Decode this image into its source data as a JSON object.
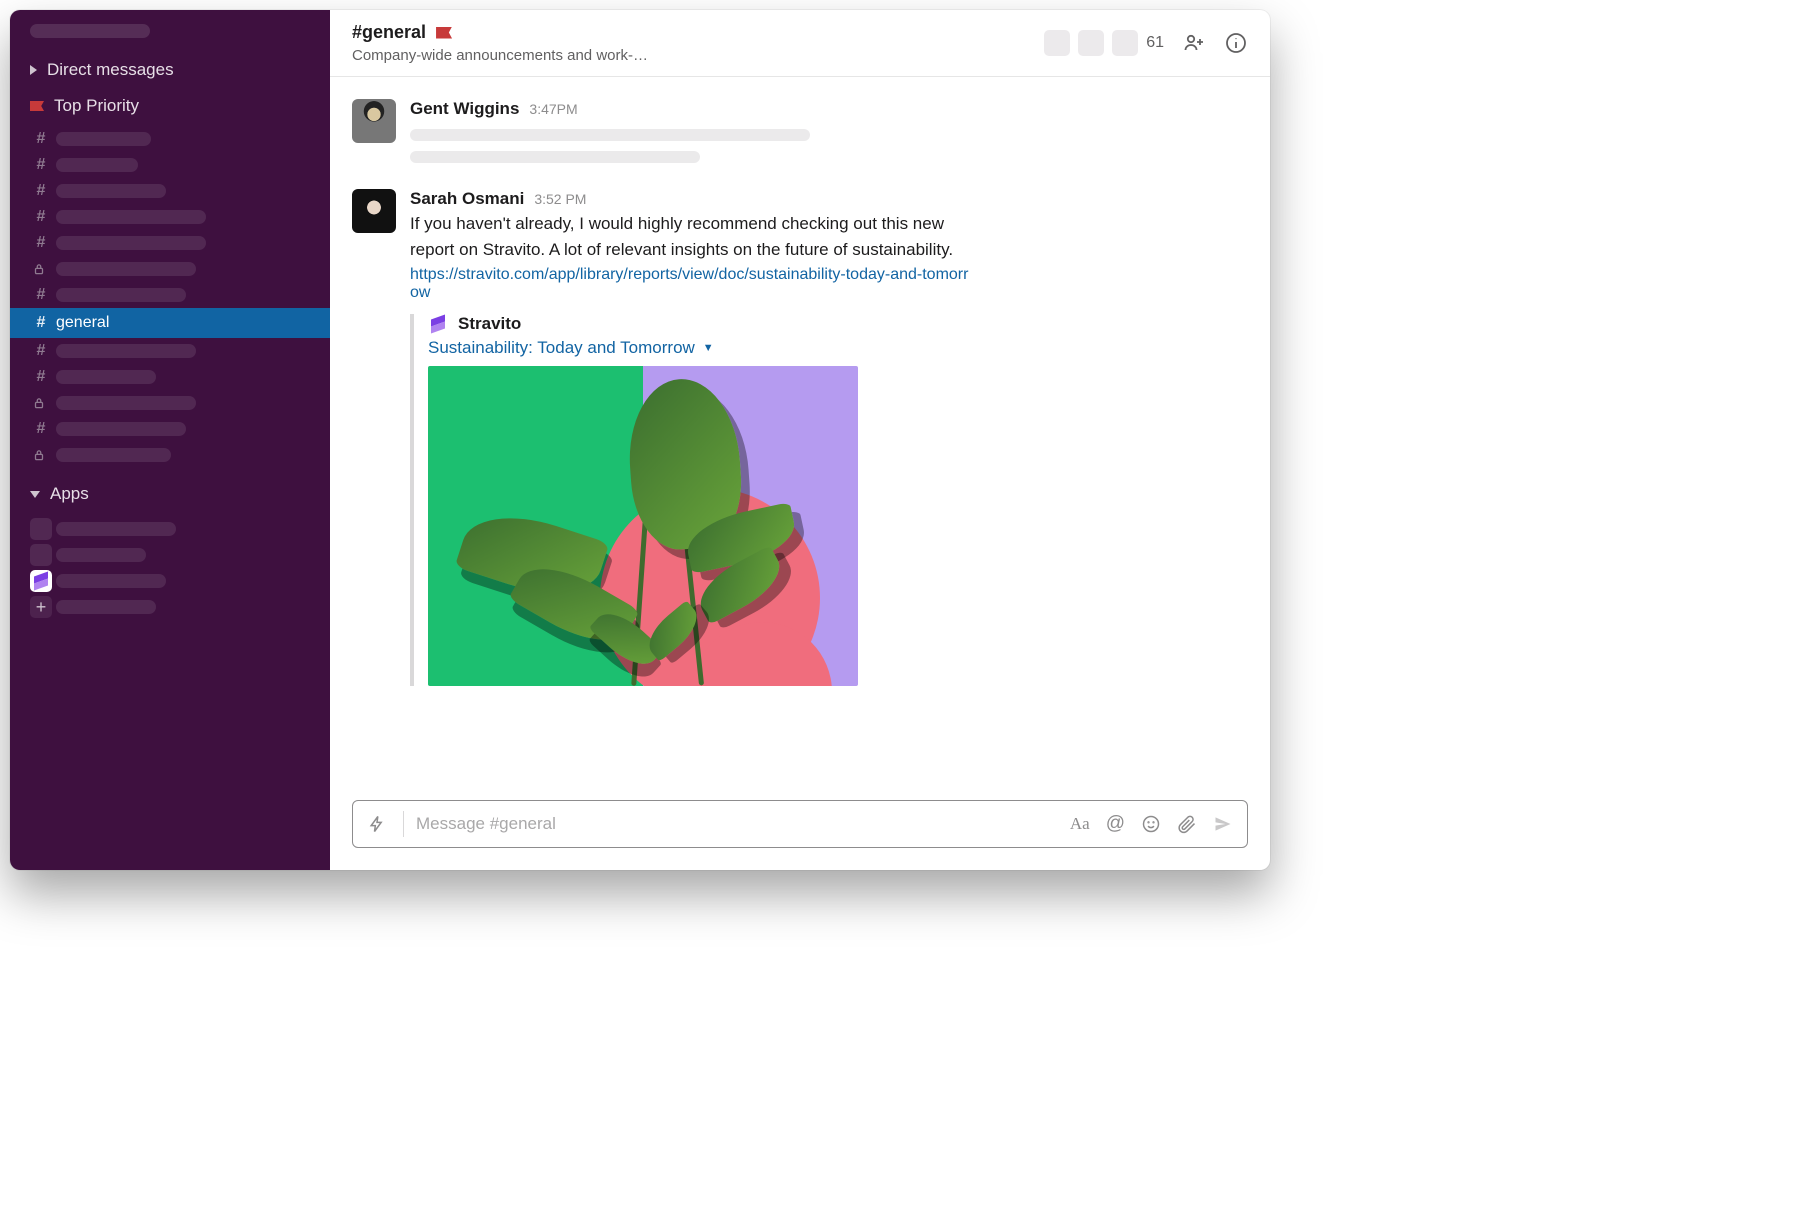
{
  "sidebar": {
    "sections": {
      "direct_messages_label": "Direct messages",
      "top_priority_label": "Top Priority",
      "apps_label": "Apps"
    },
    "channels": [
      {
        "type": "hash",
        "ph_w": 95
      },
      {
        "type": "hash",
        "ph_w": 82
      },
      {
        "type": "hash",
        "ph_w": 110
      },
      {
        "type": "hash",
        "ph_w": 150
      },
      {
        "type": "hash",
        "ph_w": 150
      },
      {
        "type": "lock",
        "ph_w": 140
      },
      {
        "type": "hash",
        "ph_w": 130
      },
      {
        "type": "hash",
        "label": "general",
        "active": true
      },
      {
        "type": "hash",
        "ph_w": 140
      },
      {
        "type": "hash",
        "ph_w": 100
      },
      {
        "type": "lock",
        "ph_w": 140
      },
      {
        "type": "hash",
        "ph_w": 130
      },
      {
        "type": "lock",
        "ph_w": 115
      }
    ],
    "apps": [
      {
        "kind": "ph",
        "ph_w": 120
      },
      {
        "kind": "ph",
        "ph_w": 90
      },
      {
        "kind": "stravito",
        "ph_w": 110
      },
      {
        "kind": "add",
        "ph_w": 100
      }
    ]
  },
  "header": {
    "channel_name": "#general",
    "topic": "Company-wide announcements and work-…",
    "member_count": "61"
  },
  "messages": [
    {
      "id": "m1",
      "author": "Gent Wiggins",
      "time": "3:47PM",
      "placeholder": true
    },
    {
      "id": "m2",
      "author": "Sarah Osmani",
      "time": "3:52 PM",
      "text": "If you haven't already, I would highly recommend checking out this new report on Stravito.  A lot of relevant insights on the future of sustainability.",
      "link": "https://stravito.com/app/library/reports/view/doc/sustainability-today-and-tomorrow",
      "attachment": {
        "app_name": "Stravito",
        "title": "Sustainability: Today and Tomorrow"
      }
    }
  ],
  "composer": {
    "placeholder": "Message #general"
  }
}
